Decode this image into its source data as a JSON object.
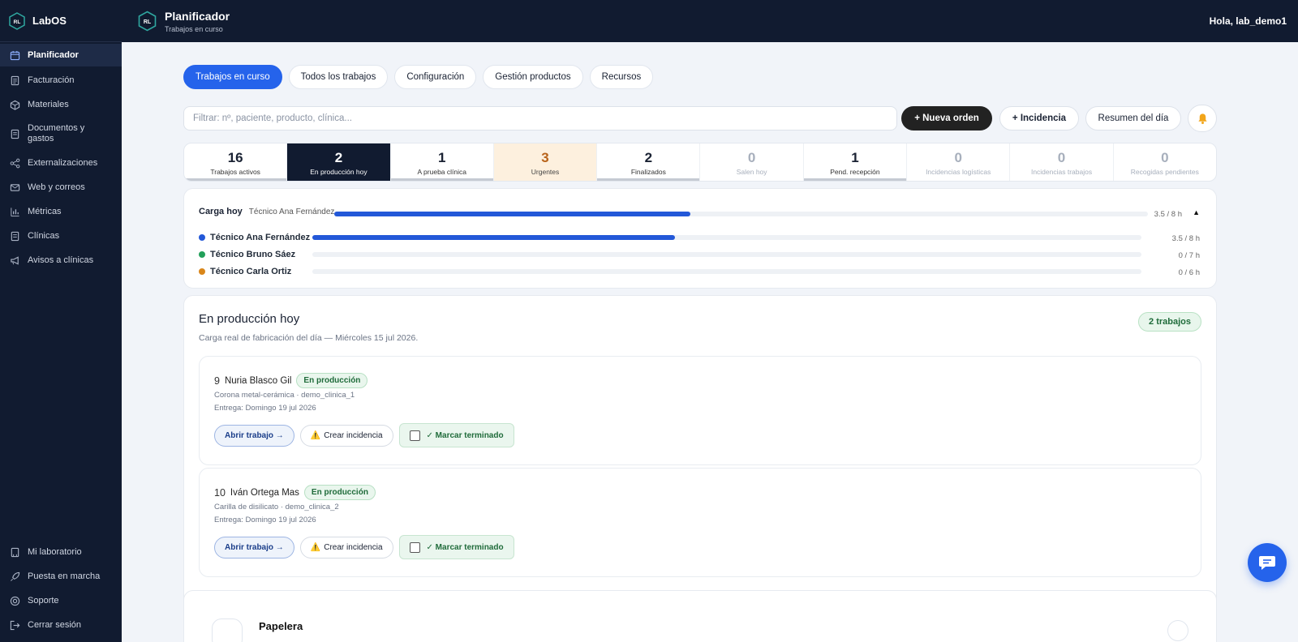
{
  "app": {
    "name": "LabOS",
    "logo_text": "RL"
  },
  "topbar": {
    "title": "Planificador",
    "subtitle": "Trabajos en curso",
    "greeting": "Hola, lab_demo1"
  },
  "sidebar": {
    "items": [
      {
        "label": "Planificador",
        "icon": "calendar-icon",
        "active": true
      },
      {
        "label": "Facturación",
        "icon": "invoice-icon"
      },
      {
        "label": "Materiales",
        "icon": "box-icon"
      },
      {
        "label": "Documentos y gastos",
        "icon": "document-icon"
      },
      {
        "label": "Externalizaciones",
        "icon": "share-icon"
      },
      {
        "label": "Web y correos",
        "icon": "mail-icon"
      },
      {
        "label": "Métricas",
        "icon": "bar-chart-icon"
      },
      {
        "label": "Clínicas",
        "icon": "clinic-icon"
      },
      {
        "label": "Avisos a clínicas",
        "icon": "megaphone-icon"
      }
    ],
    "bottom": [
      {
        "label": "Mi laboratorio",
        "icon": "lab-icon"
      },
      {
        "label": "Puesta en marcha",
        "icon": "rocket-icon"
      },
      {
        "label": "Soporte",
        "icon": "lifebuoy-icon"
      },
      {
        "label": "Cerrar sesión",
        "icon": "logout-icon"
      }
    ]
  },
  "tabs": [
    "Trabajos en curso",
    "Todos los trabajos",
    "Configuración",
    "Gestión productos",
    "Recursos"
  ],
  "filter": {
    "placeholder": "Filtrar: nº, paciente, producto, clínica..."
  },
  "buttons": {
    "new_order": "+ Nueva orden",
    "incident": "+ Incidencia",
    "summary": "Resumen del día"
  },
  "stats": [
    {
      "value": "16",
      "label": "Trabajos activos"
    },
    {
      "value": "2",
      "label": "En producción hoy"
    },
    {
      "value": "1",
      "label": "A prueba clínica"
    },
    {
      "value": "3",
      "label": "Urgentes"
    },
    {
      "value": "2",
      "label": "Finalizados"
    },
    {
      "value": "0",
      "label": "Salen hoy"
    },
    {
      "value": "1",
      "label": "Pend. recepción"
    },
    {
      "value": "0",
      "label": "Incidencias logísticas"
    },
    {
      "value": "0",
      "label": "Incidencias trabajos"
    },
    {
      "value": "0",
      "label": "Recogidas pendientes"
    }
  ],
  "load": {
    "title": "Carga hoy",
    "selected": "Técnico Ana Fernández",
    "hours": "3.5 / 8 h",
    "fraction": 0.4375,
    "technicians": [
      {
        "name": "Técnico Ana Fernández",
        "hours": "3.5 / 8 h",
        "fraction": 0.4375,
        "color": "#2358d8"
      },
      {
        "name": "Técnico Bruno Sáez",
        "hours": "0 / 7 h",
        "fraction": 0,
        "color": "#22a05a"
      },
      {
        "name": "Técnico Carla Ortiz",
        "hours": "0 / 6 h",
        "fraction": 0,
        "color": "#d9861a"
      }
    ]
  },
  "production": {
    "title": "En producción hoy",
    "subtitle": "Carga real de fabricación del día — Miércoles 15 jul 2026.",
    "count": "2 trabajos",
    "jobs": [
      {
        "num": "9",
        "patient": "Nuria Blasco Gil",
        "status": "En producción",
        "desc": "Corona metal-cerámica · demo_clinica_1",
        "date": "Entrega: Domingo 19 jul 2026"
      },
      {
        "num": "10",
        "patient": "Iván Ortega Mas",
        "status": "En producción",
        "desc": "Carilla de disilicato · demo_clinica_2",
        "date": "Entrega: Domingo 19 jul 2026"
      }
    ],
    "actions": {
      "open": "Abrir trabajo →",
      "incident": "Crear incidencia",
      "done": "✓ Marcar terminado"
    }
  },
  "trash": {
    "title": "Papelera"
  }
}
